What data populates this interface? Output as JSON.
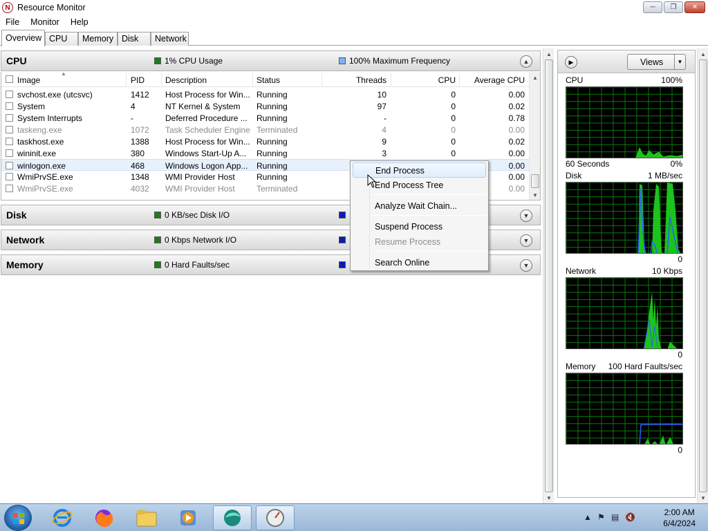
{
  "window": {
    "title": "Resource Monitor",
    "buttons": [
      "minimize",
      "maximize",
      "close"
    ]
  },
  "menu": [
    "File",
    "Monitor",
    "Help"
  ],
  "tabs": [
    {
      "label": "Overview",
      "active": true
    },
    {
      "label": "CPU"
    },
    {
      "label": "Memory"
    },
    {
      "label": "Disk"
    },
    {
      "label": "Network"
    }
  ],
  "sections": {
    "cpu": {
      "title": "CPU",
      "indicator1": "1% CPU Usage",
      "indicator1_color": "#1e7b1e",
      "indicator2": "100% Maximum Frequency",
      "indicator2_color": "#7fb2f0",
      "columns": [
        "Image",
        "PID",
        "Description",
        "Status",
        "Threads",
        "CPU",
        "Average CPU"
      ],
      "rows": [
        {
          "image": "svchost.exe (utcsvc)",
          "pid": "1412",
          "description": "Host Process for Win...",
          "status": "Running",
          "threads": "10",
          "cpu": "0",
          "avg_cpu": "0.00",
          "terminated": false
        },
        {
          "image": "System",
          "pid": "4",
          "description": "NT Kernel & System",
          "status": "Running",
          "threads": "97",
          "cpu": "0",
          "avg_cpu": "0.02",
          "terminated": false
        },
        {
          "image": "System Interrupts",
          "pid": "-",
          "description": "Deferred Procedure ...",
          "status": "Running",
          "threads": "-",
          "cpu": "0",
          "avg_cpu": "0.78",
          "terminated": false
        },
        {
          "image": "taskeng.exe",
          "pid": "1072",
          "description": "Task Scheduler Engine",
          "status": "Terminated",
          "threads": "4",
          "cpu": "0",
          "avg_cpu": "0.00",
          "terminated": true
        },
        {
          "image": "taskhost.exe",
          "pid": "1388",
          "description": "Host Process for Win...",
          "status": "Running",
          "threads": "9",
          "cpu": "0",
          "avg_cpu": "0.02",
          "terminated": false
        },
        {
          "image": "wininit.exe",
          "pid": "380",
          "description": "Windows Start-Up A...",
          "status": "Running",
          "threads": "3",
          "cpu": "0",
          "avg_cpu": "0.00",
          "terminated": false
        },
        {
          "image": "winlogon.exe",
          "pid": "468",
          "description": "Windows Logon App...",
          "status": "Running",
          "threads": "",
          "cpu": "",
          "avg_cpu": "0.00",
          "terminated": false,
          "selected": true
        },
        {
          "image": "WmiPrvSE.exe",
          "pid": "1348",
          "description": "WMI Provider Host",
          "status": "Running",
          "threads": "",
          "cpu": "",
          "avg_cpu": "0.00",
          "terminated": false
        },
        {
          "image": "WmiPrvSE.exe",
          "pid": "4032",
          "description": "WMI Provider Host",
          "status": "Terminated",
          "threads": "",
          "cpu": "",
          "avg_cpu": "0.00",
          "terminated": true
        }
      ]
    },
    "disk": {
      "title": "Disk",
      "indicator1": "0 KB/sec Disk I/O",
      "indicator1_color": "#1e7b1e",
      "indicator2_color": "#0a1ab5"
    },
    "network": {
      "title": "Network",
      "indicator1": "0 Kbps Network I/O",
      "indicator1_color": "#1e7b1e",
      "indicator2_color": "#0a1ab5"
    },
    "memory": {
      "title": "Memory",
      "indicator1": "0 Hard Faults/sec",
      "indicator1_color": "#1e7b1e",
      "indicator2_color": "#0a1ab5"
    }
  },
  "context_menu": {
    "items": [
      {
        "label": "End Process",
        "highlighted": true
      },
      {
        "label": "End Process Tree"
      },
      {
        "label": "Analyze Wait Chain..."
      },
      {
        "label": "Suspend Process"
      },
      {
        "label": "Resume Process",
        "disabled": true
      },
      {
        "label": "Search Online"
      }
    ]
  },
  "right_panel": {
    "views_label": "Views",
    "graphs": [
      {
        "name": "CPU",
        "max": "100%",
        "footer_left": "60 Seconds",
        "footer_right": "0%"
      },
      {
        "name": "Disk",
        "max": "1 MB/sec",
        "footer_right": "0"
      },
      {
        "name": "Network",
        "max": "10 Kbps",
        "footer_right": "0"
      },
      {
        "name": "Memory",
        "max": "100 Hard Faults/sec",
        "footer_right": "0"
      }
    ]
  },
  "taskbar": {
    "pinned": [
      "start-orb",
      "internet-explorer-icon",
      "firefox-icon",
      "file-explorer-icon",
      "media-player-icon",
      "app-icon",
      "resource-monitor-icon"
    ],
    "clock_time": "2:00 AM",
    "clock_date": "6/4/2024"
  }
}
